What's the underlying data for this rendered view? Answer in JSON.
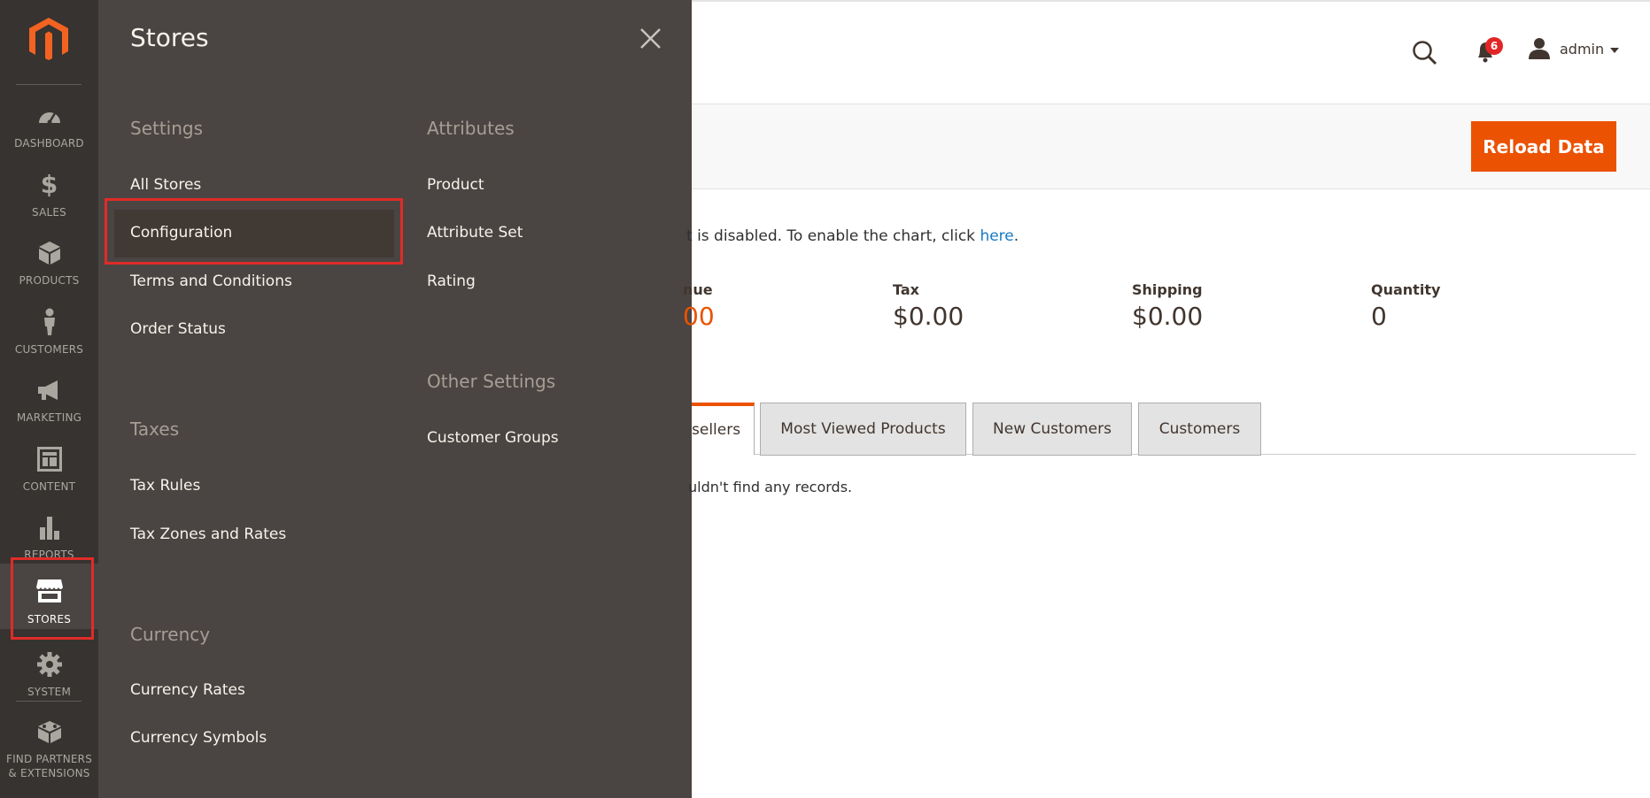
{
  "nav": {
    "items": [
      {
        "label": "DASHBOARD",
        "icon": "dashboard-icon"
      },
      {
        "label": "SALES",
        "icon": "dollar-icon"
      },
      {
        "label": "PRODUCTS",
        "icon": "cube-icon"
      },
      {
        "label": "CUSTOMERS",
        "icon": "person-icon"
      },
      {
        "label": "MARKETING",
        "icon": "megaphone-icon"
      },
      {
        "label": "CONTENT",
        "icon": "layout-icon"
      },
      {
        "label": "REPORTS",
        "icon": "bar-chart-icon"
      },
      {
        "label": "STORES",
        "icon": "storefront-icon"
      },
      {
        "label": "SYSTEM",
        "icon": "gear-icon"
      },
      {
        "label_line1": "FIND PARTNERS",
        "label_line2": "& EXTENSIONS",
        "icon": "blocks-icon"
      }
    ]
  },
  "flyout": {
    "title": "Stores",
    "settings": {
      "title": "Settings",
      "items": [
        "All Stores",
        "Configuration",
        "Terms and Conditions",
        "Order Status"
      ]
    },
    "taxes": {
      "title": "Taxes",
      "items": [
        "Tax Rules",
        "Tax Zones and Rates"
      ]
    },
    "currency": {
      "title": "Currency",
      "items": [
        "Currency Rates",
        "Currency Symbols"
      ]
    },
    "attributes": {
      "title": "Attributes",
      "items": [
        "Product",
        "Attribute Set",
        "Rating"
      ]
    },
    "other": {
      "title": "Other Settings",
      "items": [
        "Customer Groups"
      ]
    }
  },
  "header": {
    "notifications_count": "6",
    "user_name": "admin"
  },
  "actions": {
    "reload_label": "Reload Data"
  },
  "chart_note": {
    "text": "t is disabled. To enable the chart, click ",
    "link": "here",
    "end": "."
  },
  "stats": {
    "revenue": {
      "label": "nue",
      "value": "00"
    },
    "tax": {
      "label": "Tax",
      "value": "$0.00"
    },
    "shipping": {
      "label": "Shipping",
      "value": "$0.00"
    },
    "quantity": {
      "label": "Quantity",
      "value": "0"
    }
  },
  "tabs": [
    "sellers",
    "Most Viewed Products",
    "New Customers",
    "Customers"
  ],
  "empty_message": "uldn't find any records.",
  "colors": {
    "accent": "#eb5202",
    "nav_bg": "#373330",
    "flyout_bg": "#4a4542",
    "highlight_box": "#e02b27",
    "link": "#1979c3"
  }
}
